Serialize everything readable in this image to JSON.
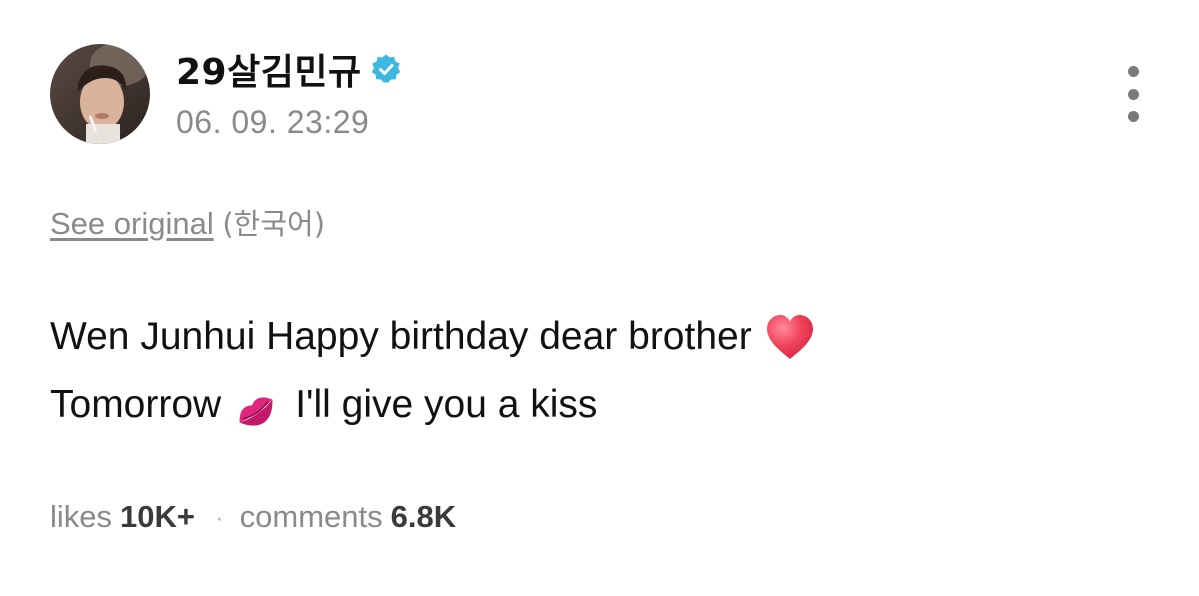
{
  "author": {
    "name": "29살김민규",
    "verified": true,
    "timestamp": "06. 09. 23:29"
  },
  "translation": {
    "see_original_label": "See original",
    "language_label": "(한국어)"
  },
  "post": {
    "line1_text": "Wen Junhui Happy birthday dear brother",
    "line1_emoji": "red-heart-icon",
    "line2_text_a": "Tomorrow",
    "line2_emoji": "kiss-mark-icon",
    "line2_text_b": "I'll give you a kiss"
  },
  "stats": {
    "likes_label": "likes",
    "likes_value": "10K+",
    "separator": "·",
    "comments_label": "comments",
    "comments_value": "6.8K"
  },
  "colors": {
    "verified_badge": "#3db8e0",
    "muted_text": "#8a8a8a",
    "primary_text": "#111111",
    "heart": "#e8354e",
    "lips": "#e0257e"
  }
}
